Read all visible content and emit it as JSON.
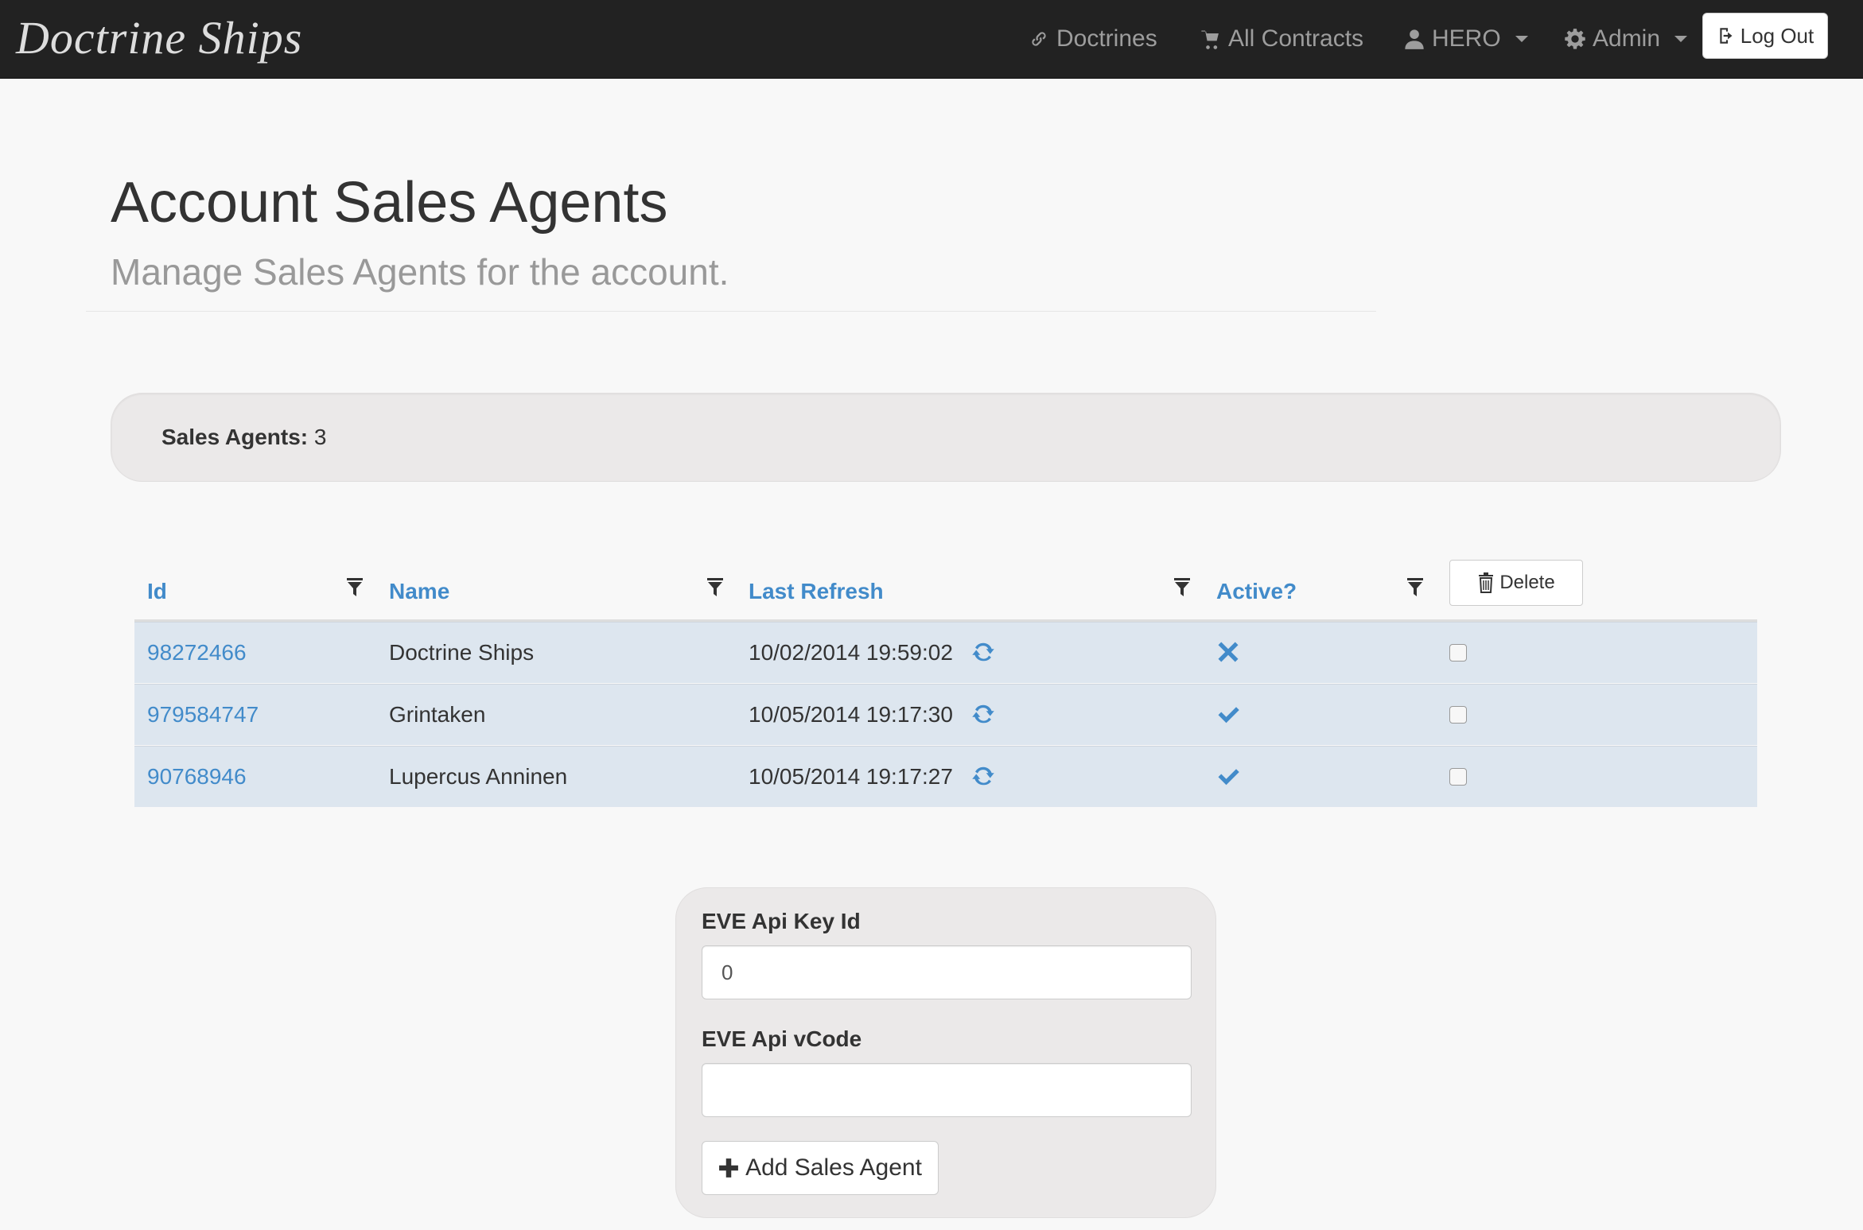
{
  "brand": "Doctrine Ships",
  "nav": {
    "doctrines": "Doctrines",
    "all_contracts": "All Contracts",
    "user": "HERO",
    "admin": "Admin",
    "logout": "Log Out"
  },
  "header": {
    "title": "Account Sales Agents",
    "subtitle": "Manage Sales Agents for the account."
  },
  "summary": {
    "label": "Sales Agents:",
    "count": "3"
  },
  "table": {
    "columns": [
      "Id",
      "Name",
      "Last Refresh",
      "Active?"
    ],
    "delete_label": "Delete",
    "rows": [
      {
        "id": "98272466",
        "name": "Doctrine Ships",
        "last_refresh": "10/02/2014 19:59:02",
        "active": false
      },
      {
        "id": "979584747",
        "name": "Grintaken",
        "last_refresh": "10/05/2014 19:17:30",
        "active": true
      },
      {
        "id": "90768946",
        "name": "Lupercus Anninen",
        "last_refresh": "10/05/2014 19:17:27",
        "active": true
      }
    ]
  },
  "form": {
    "key_id_label": "EVE Api Key Id",
    "key_id_value": "0",
    "vcode_label": "EVE Api vCode",
    "vcode_value": "",
    "submit_label": "Add Sales Agent"
  },
  "colors": {
    "navbar": "#222222",
    "link": "#428bca",
    "row_bg": "#dde6ef"
  }
}
